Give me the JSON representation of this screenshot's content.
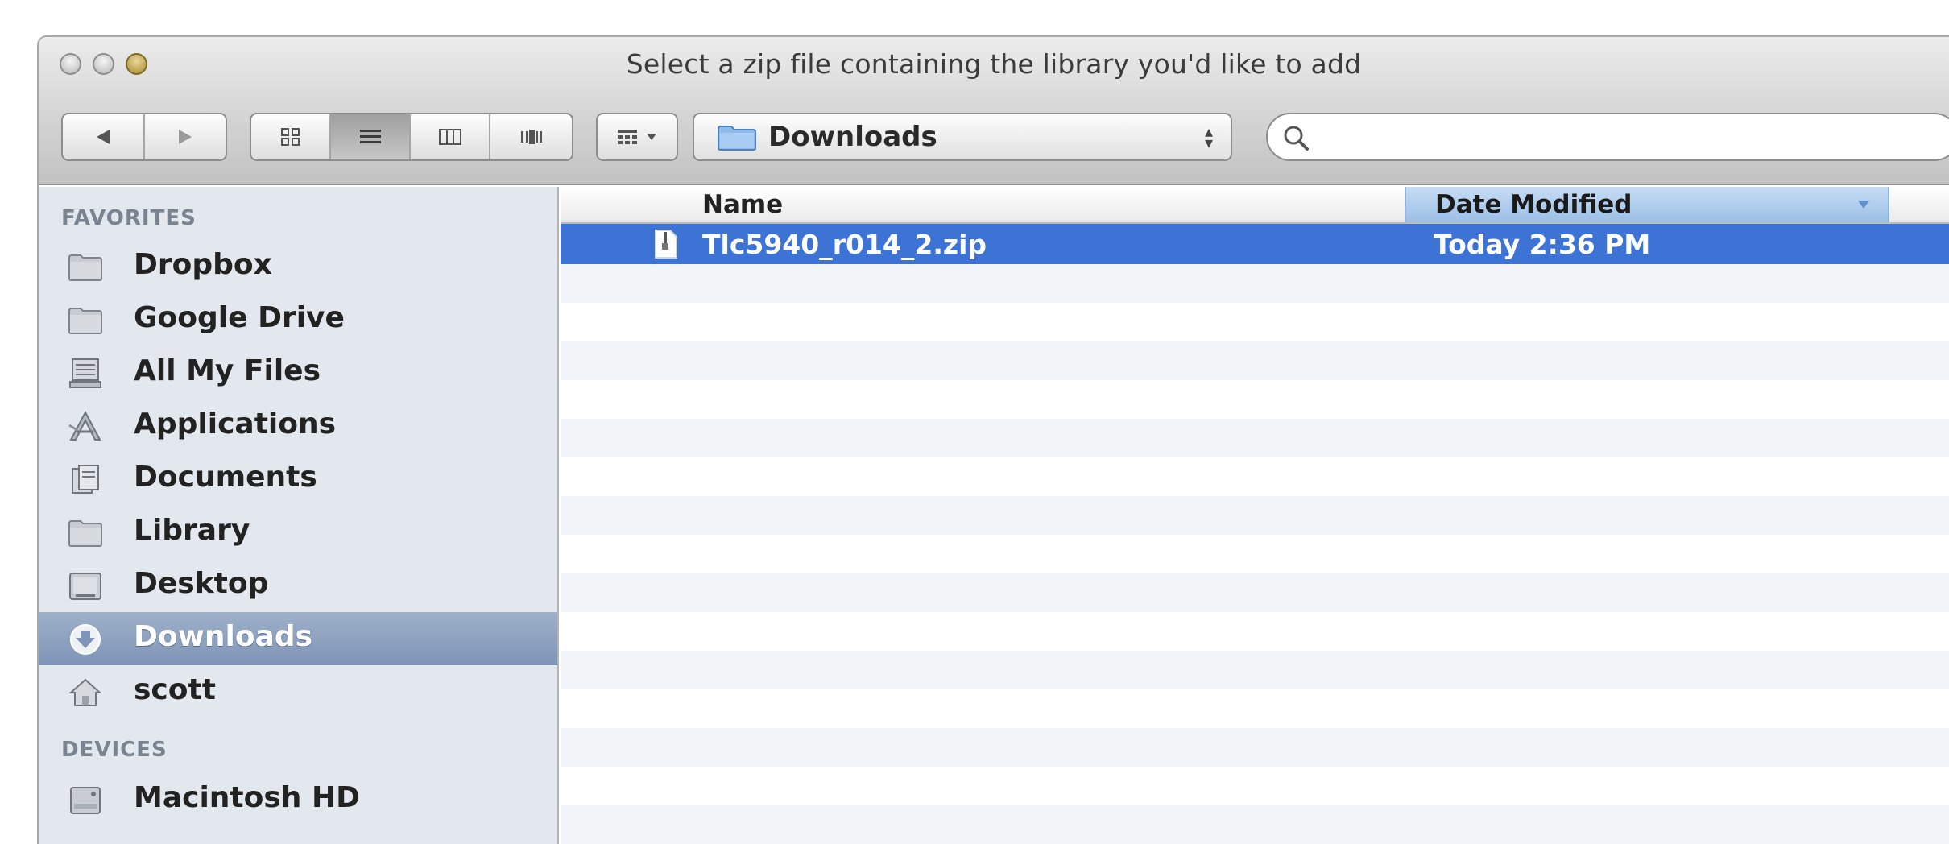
{
  "window": {
    "title": "Select a zip file containing the library you'd like to add"
  },
  "toolbar": {
    "nav": [
      "back-arrow-icon",
      "forward-arrow-icon"
    ],
    "view_modes": [
      "icon-view-icon",
      "list-view-icon",
      "column-view-icon",
      "cover-flow-icon"
    ],
    "active_view": "list-view-icon",
    "arrange_icon": "arrange-grid-icon",
    "location": "Downloads",
    "search": {
      "value": "",
      "placeholder": ""
    }
  },
  "sidebar": {
    "favorites_header": "FAVORITES",
    "favorites": [
      {
        "label": "Dropbox",
        "icon": "folder-icon"
      },
      {
        "label": "Google Drive",
        "icon": "folder-icon"
      },
      {
        "label": "All My Files",
        "icon": "all-files-icon"
      },
      {
        "label": "Applications",
        "icon": "applications-icon"
      },
      {
        "label": "Documents",
        "icon": "documents-icon"
      },
      {
        "label": "Library",
        "icon": "folder-icon"
      },
      {
        "label": "Desktop",
        "icon": "desktop-icon"
      },
      {
        "label": "Downloads",
        "icon": "downloads-icon",
        "selected": true
      },
      {
        "label": "scott",
        "icon": "home-icon"
      }
    ],
    "devices_header": "DEVICES",
    "devices": [
      {
        "label": "Macintosh HD",
        "icon": "hard-drive-icon"
      }
    ]
  },
  "file_list": {
    "columns": {
      "name": "Name",
      "date": "Date Modified"
    },
    "sorted_by": "Date Modified",
    "rows": [
      {
        "name": "Tlc5940_r014_2.zip",
        "date": "Today 2:36 PM",
        "icon": "zip-file-icon",
        "selected": true
      }
    ]
  },
  "colors": {
    "selection": "#3c73d5",
    "sidebar_bg": "#e3e8ee",
    "sidebar_selected": "#8ea3c2",
    "column_sorted": "#b3d0ef"
  }
}
